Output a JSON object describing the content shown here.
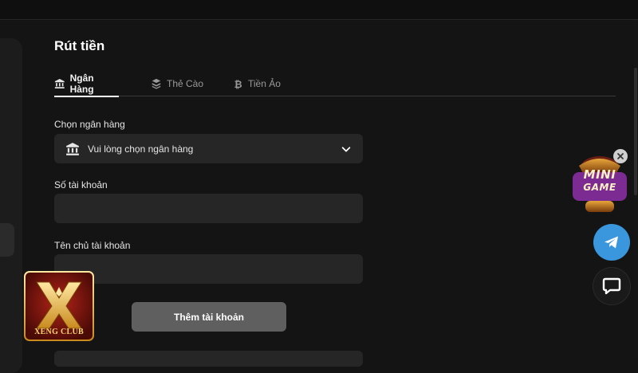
{
  "page": {
    "title": "Rút tiền"
  },
  "tabs": [
    {
      "label": "Ngân Hàng",
      "icon": "bank-icon",
      "active": true
    },
    {
      "label": "Thẻ Cào",
      "icon": "card-stack-icon",
      "active": false
    },
    {
      "label": "Tiền Ảo",
      "icon": "bitcoin-icon",
      "active": false
    }
  ],
  "form": {
    "bank_label": "Chọn ngân hàng",
    "bank_placeholder": "Vui lòng chọn ngân hàng",
    "account_number_label": "Số tài khoản",
    "account_number_value": "",
    "account_holder_label": "Tên chủ tài khoản",
    "account_holder_value": "",
    "add_button": "Thêm tài khoản"
  },
  "widgets": {
    "logo_text": "XENG CLUB",
    "mini_game_line1": "MINI",
    "mini_game_line2": "GAME",
    "telegram_icon": "telegram-icon",
    "chat_icon": "chat-bubble-icon"
  },
  "colors": {
    "background": "#141414",
    "field": "#262626",
    "button": "#5f5f5f",
    "telegram": "#3a97dd",
    "logo_gold": "#f7d774"
  }
}
